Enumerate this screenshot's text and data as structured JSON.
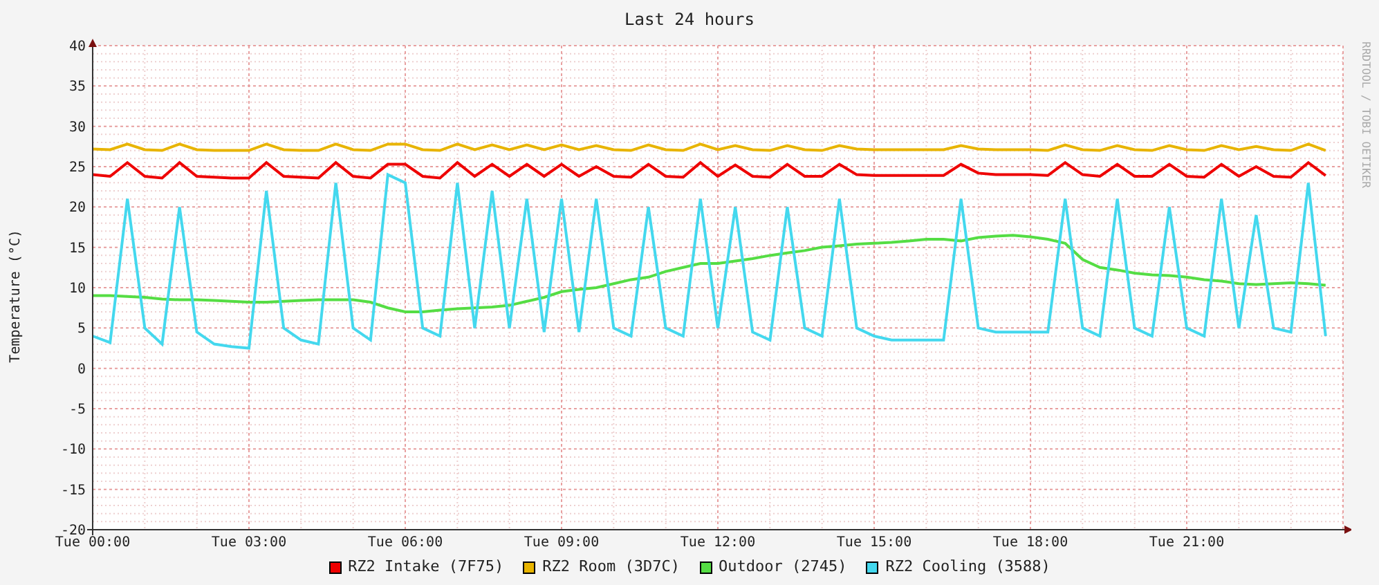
{
  "graph": {
    "chart_data": {
      "type": "line",
      "grid": true,
      "title": "Last 24 hours",
      "ylabel": "Temperature (°C)",
      "ylim": [
        -20,
        40
      ],
      "yticks": [
        -20,
        -15,
        -10,
        -5,
        0,
        5,
        10,
        15,
        20,
        25,
        30,
        35,
        40
      ],
      "categories": [
        "Tue 00:00",
        null,
        null,
        null,
        null,
        null,
        null,
        null,
        null,
        "Tue 03:00",
        null,
        null,
        null,
        null,
        null,
        null,
        null,
        null,
        "Tue 06:00",
        null,
        null,
        null,
        null,
        null,
        null,
        null,
        null,
        "Tue 09:00",
        null,
        null,
        null,
        null,
        null,
        null,
        null,
        null,
        "Tue 12:00",
        null,
        null,
        null,
        null,
        null,
        null,
        null,
        null,
        "Tue 15:00",
        null,
        null,
        null,
        null,
        null,
        null,
        null,
        null,
        "Tue 18:00",
        null,
        null,
        null,
        null,
        null,
        null,
        null,
        null,
        "Tue 21:00",
        null,
        null,
        null,
        null,
        null,
        null,
        null,
        null
      ],
      "series": [
        {
          "name": "RZ2 Intake (7F75)",
          "color": "#ee0000",
          "values": [
            24,
            23.8,
            25.5,
            23.8,
            23.6,
            25.5,
            23.8,
            23.7,
            23.6,
            23.6,
            25.5,
            23.8,
            23.7,
            23.6,
            25.5,
            23.8,
            23.6,
            25.3,
            25.3,
            23.8,
            23.6,
            25.5,
            23.8,
            25.3,
            23.8,
            25.3,
            23.8,
            25.3,
            23.8,
            25,
            23.8,
            23.7,
            25.3,
            23.8,
            23.7,
            25.5,
            23.8,
            25.2,
            23.8,
            23.7,
            25.3,
            23.8,
            23.8,
            25.3,
            24,
            23.9,
            23.9,
            23.9,
            23.9,
            23.9,
            25.3,
            24.2,
            24,
            24,
            24,
            23.9,
            25.5,
            24,
            23.8,
            25.3,
            23.8,
            23.8,
            25.3,
            23.8,
            23.7,
            25.3,
            23.8,
            25,
            23.8,
            23.7,
            25.5,
            23.9
          ]
        },
        {
          "name": "RZ2 Room (3D7C)",
          "color": "#e8b400",
          "values": [
            27.2,
            27.1,
            27.8,
            27.1,
            27,
            27.8,
            27.1,
            27,
            27,
            27,
            27.8,
            27.1,
            27,
            27,
            27.8,
            27.1,
            27,
            27.8,
            27.8,
            27.1,
            27,
            27.8,
            27.1,
            27.7,
            27.1,
            27.7,
            27.1,
            27.7,
            27.1,
            27.6,
            27.1,
            27,
            27.7,
            27.1,
            27,
            27.8,
            27.1,
            27.6,
            27.1,
            27,
            27.6,
            27.1,
            27,
            27.6,
            27.2,
            27.1,
            27.1,
            27.1,
            27.1,
            27.1,
            27.6,
            27.2,
            27.1,
            27.1,
            27.1,
            27,
            27.7,
            27.1,
            27,
            27.6,
            27.1,
            27,
            27.6,
            27.1,
            27,
            27.6,
            27.1,
            27.5,
            27.1,
            27,
            27.8,
            27
          ]
        },
        {
          "name": "Outdoor (2745)",
          "color": "#55dd44",
          "values": [
            9,
            9,
            8.9,
            8.8,
            8.6,
            8.5,
            8.5,
            8.4,
            8.3,
            8.2,
            8.2,
            8.3,
            8.4,
            8.5,
            8.5,
            8.5,
            8.2,
            7.5,
            7,
            7,
            7.2,
            7.4,
            7.5,
            7.6,
            7.8,
            8.3,
            8.8,
            9.5,
            9.8,
            10,
            10.5,
            11,
            11.3,
            12,
            12.5,
            13,
            13,
            13.3,
            13.6,
            14,
            14.3,
            14.6,
            15,
            15.2,
            15.4,
            15.5,
            15.6,
            15.8,
            16,
            16,
            15.8,
            16.2,
            16.4,
            16.5,
            16.3,
            16,
            15.5,
            13.5,
            12.5,
            12.2,
            11.8,
            11.6,
            11.5,
            11.3,
            11,
            10.8,
            10.5,
            10.4,
            10.5,
            10.6,
            10.5,
            10.3
          ]
        },
        {
          "name": "RZ2 Cooling (3588)",
          "color": "#44d8ee",
          "values": [
            4,
            3.2,
            21,
            5,
            3,
            20,
            4.5,
            3,
            2.7,
            2.5,
            22,
            5,
            3.5,
            3,
            23,
            5,
            3.5,
            24,
            23,
            5,
            4,
            23,
            5,
            22,
            5,
            21,
            4.5,
            21,
            4.5,
            21,
            5,
            4,
            20,
            5,
            4,
            21,
            5,
            20,
            4.5,
            3.5,
            20,
            5,
            4,
            21,
            5,
            4,
            3.5,
            3.5,
            3.5,
            3.5,
            21,
            5,
            4.5,
            4.5,
            4.5,
            4.5,
            21,
            5,
            4,
            21,
            5,
            4,
            20,
            5,
            4,
            21,
            5,
            19,
            5,
            4.5,
            23,
            4
          ]
        }
      ]
    }
  },
  "credit": "RRDTOOL / TOBI OETIKER"
}
